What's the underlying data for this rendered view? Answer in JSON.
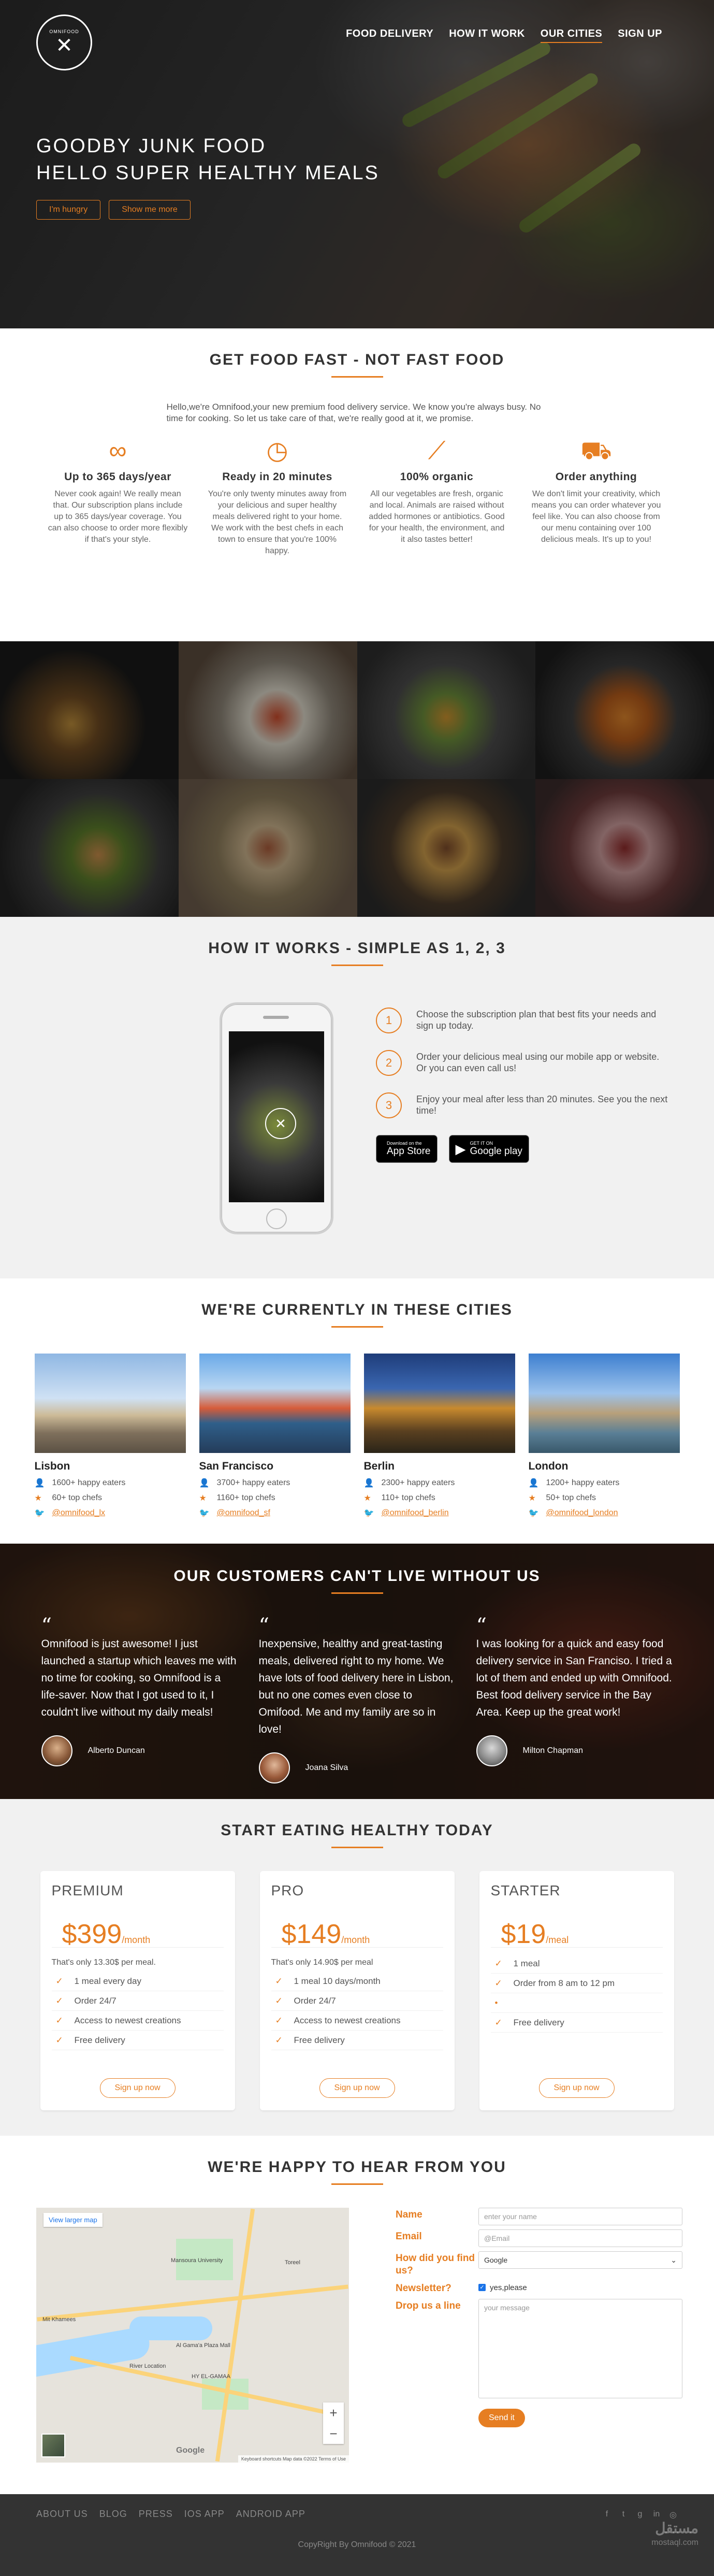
{
  "header": {
    "logo_text": "OMNIFOOD",
    "nav": [
      "FOOD DELIVERY",
      "HOW IT WORK",
      "OUR CITIES",
      "SIGN UP"
    ],
    "headline_line1": "GOODBY JUNK FOOD",
    "headline_line2": "HELLO SUPER HEALTHY MEALS",
    "btn_hungry": "I'm hungry",
    "btn_more": "Show me more"
  },
  "features": {
    "title": "GET FOOD FAST - NOT FAST FOOD",
    "intro": "Hello,we're Omnifood,your new premium food delivery service. We know you're always busy. No time for cooking. So let us take care of that, we're really good at it, we promise.",
    "items": [
      {
        "icon": "infinity-icon",
        "title": "Up to 365 days/year",
        "text": "Never cook again! We really mean that. Our subscription plans include up to 365 days/year coverage. You can also choose to order more flexibly if that's your style."
      },
      {
        "icon": "stopwatch-icon",
        "title": "Ready in 20 minutes",
        "text": "You're only twenty minutes away from your delicious and super healthy meals delivered right to your home. We work with the best chefs in each town to ensure that you're 100% happy."
      },
      {
        "icon": "carrot-icon",
        "title": "100% organic",
        "text": "All our vegetables are fresh, organic and local. Animals are raised without added hormones or antibiotics. Good for your health, the environment, and it also tastes better!"
      },
      {
        "icon": "cart-icon",
        "title": "Order anything",
        "text": "We don't limit your creativity, which means you can order whatever you feel like. You can also choose from our menu containing over 100 delicious meals. It's up to you!"
      }
    ]
  },
  "steps": {
    "title": "HOW IT WORKS - SIMPLE AS 1, 2, 3",
    "items": [
      {
        "num": "1",
        "text": "Choose the subscription plan that best fits your needs and sign up today."
      },
      {
        "num": "2",
        "text": "Order your delicious meal using our mobile app or website. Or you can even call us!"
      },
      {
        "num": "3",
        "text": "Enjoy your meal after less than 20 minutes. See you the next time!"
      }
    ],
    "appstore_small": "Download on the",
    "appstore_big": "App Store",
    "googleplay_small": "GET IT ON",
    "googleplay_big": "Google play"
  },
  "cities": {
    "title": "WE'RE CURRENTLY IN THESE CITIES",
    "items": [
      {
        "name": "Lisbon",
        "eaters": "1600+ happy eaters",
        "chefs": "60+ top chefs",
        "twitter": "@omnifood_lx"
      },
      {
        "name": "San Francisco",
        "eaters": "3700+ happy eaters",
        "chefs": "1160+ top chefs",
        "twitter": "@omnifood_sf"
      },
      {
        "name": "Berlin",
        "eaters": "2300+ happy eaters",
        "chefs": "110+ top chefs",
        "twitter": "@omnifood_berlin"
      },
      {
        "name": "London",
        "eaters": "1200+ happy eaters",
        "chefs": "50+ top chefs",
        "twitter": "@omnifood_london"
      }
    ]
  },
  "testimonials": {
    "title": "OUR CUSTOMERS CAN'T LIVE WITHOUT US",
    "items": [
      {
        "text": "Omnifood is just awesome! I just launched a startup which leaves me with no time for cooking, so Omnifood is a life-saver. Now that I got used to it, I couldn't live without my daily meals!",
        "name": "Alberto Duncan"
      },
      {
        "text": "Inexpensive, healthy and great-tasting meals, delivered right to my home. We have lots of food delivery here in Lisbon, but no one comes even close to Omifood. Me and my family are so in love!",
        "name": "Joana Silva"
      },
      {
        "text": "I was looking for a quick and easy food delivery service in San Franciso. I tried a lot of them and ended up with Omnifood. Best food delivery service in the Bay Area. Keep up the great work!",
        "name": "Milton Chapman"
      }
    ]
  },
  "plans": {
    "title": "START EATING HEALTHY TODAY",
    "items": [
      {
        "name": "PREMIUM",
        "price": "$399",
        "per": "/month",
        "sub": "That's only 13.30$ per meal.",
        "features": [
          "1 meal every day",
          "Order 24/7",
          "Access to newest creations",
          "Free delivery"
        ],
        "button": "Sign up now"
      },
      {
        "name": "PRO",
        "price": "$149",
        "per": "/month",
        "sub": "That's only 14.90$ per meal",
        "features": [
          "1 meal 10 days/month",
          "Order 24/7",
          "Access to newest creations",
          "Free delivery"
        ],
        "button": "Sign up now"
      },
      {
        "name": "STARTER",
        "price": "$19",
        "per": "/meal",
        "sub": "",
        "features": [
          "1 meal",
          "Order from 8 am to 12 pm",
          "",
          "Free delivery"
        ],
        "button": "Sign up now"
      }
    ]
  },
  "contact": {
    "title": "WE'RE HAPPY TO HEAR FROM YOU",
    "map_link": "View larger map",
    "map_labels": [
      "Mansoura University",
      "Mit Khamees",
      "Al Gama'a Plaza Mall",
      "Toreel",
      "HY EL-GAMAA",
      "River Location"
    ],
    "map_credit": "Keyboard shortcuts   Map data ©2022   Terms of Use",
    "map_brand": "Google",
    "label_name": "Name",
    "label_email": "Email",
    "label_find": "How did you find us?",
    "label_news": "Newsletter?",
    "label_drop": "Drop us a line",
    "ph_name": "enter your name",
    "ph_email": "@Email",
    "select_value": "Google",
    "check_label": "yes,please",
    "ph_message": "your message",
    "send": "Send it"
  },
  "footer": {
    "nav": [
      "ABOUT US",
      "BLOG",
      "PRESS",
      "IOS APP",
      "ANDROID APP"
    ],
    "social": [
      "facebook-icon",
      "twitter-icon",
      "googleplus-icon",
      "linkedin-icon",
      "dribbble-icon"
    ],
    "copyright": "CopyRight By Omnifood © 2021",
    "watermark_big": "مستقل",
    "watermark_small": "mostaql.com"
  },
  "colors": {
    "accent": "#e67e22",
    "dark": "#333333",
    "light_bg": "#f1f1f1"
  }
}
